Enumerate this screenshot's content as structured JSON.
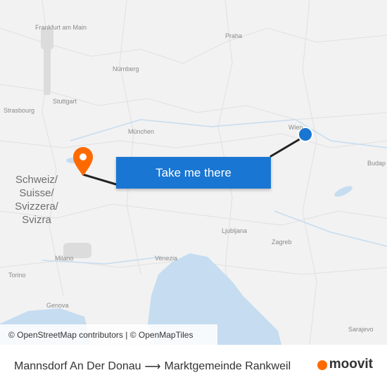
{
  "map": {
    "cities": {
      "frankfurt": "Frankfurt am Main",
      "praha": "Praha",
      "nurnberg": "Nürnberg",
      "stuttgart": "Stuttgart",
      "strasbourg": "Strasbourg",
      "munchen": "München",
      "wien": "Wien",
      "budapest": "Budap",
      "ljubljana": "Ljubljana",
      "zagreb": "Zagreb",
      "venezia": "Venezia",
      "milano": "Milano",
      "torino": "Torino",
      "genova": "Genova",
      "sarajevo": "Sarajevo"
    },
    "country_label": "Schweiz/ Suisse/ Svizzera/ Svizra",
    "colors": {
      "route": "#222222",
      "origin": "#1976d2",
      "destination": "#ff6a00",
      "water": "#c6dcf0"
    }
  },
  "cta": {
    "label": "Take me there"
  },
  "attribution": "© OpenStreetMap contributors | © OpenMapTiles",
  "footer": {
    "origin": "Mannsdorf An Der Donau",
    "arrow": "⟶",
    "destination": "Marktgemeinde Rankweil",
    "brand": "moovit"
  }
}
